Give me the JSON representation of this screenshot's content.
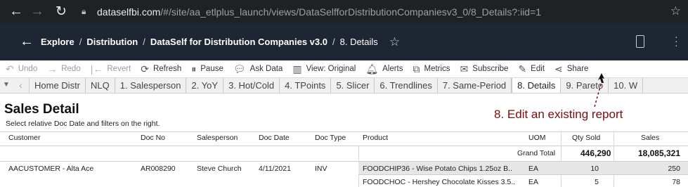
{
  "browser": {
    "url_host": "dataselfbi.com",
    "url_path": "/#/site/aa_etlplus_launch/views/DataSelfforDistributionCompaniesv3_0/8_Details?:iid=1"
  },
  "header": {
    "breadcrumbs": [
      "Explore",
      "Distribution",
      "DataSelf for Distribution Companies v3.0",
      "8. Details"
    ],
    "sep": "/"
  },
  "toolbar": {
    "undo": "Undo",
    "redo": "Redo",
    "revert": "Revert",
    "refresh": "Refresh",
    "pause": "Pause",
    "ask_data": "Ask Data",
    "view": "View: Original",
    "alerts": "Alerts",
    "metrics": "Metrics",
    "subscribe": "Subscribe",
    "edit": "Edit",
    "share": "Share"
  },
  "tabs": [
    "Home Distr",
    "NLQ",
    "1. Salesperson",
    "2. YoY",
    "3. Hot/Cold",
    "4. TPoints",
    "5. Slicer",
    "6. Trendlines",
    "7. Same-Period",
    "8. Details",
    "9. Pareto",
    "10. W"
  ],
  "active_tab": "8. Details",
  "dashboard": {
    "title": "Sales Detail",
    "subtitle": "Select relative Doc Date and filters on the right.",
    "annotation": "8.  Edit an existing report",
    "columns": {
      "customer": "Customer",
      "doc_no": "Doc No",
      "salesperson": "Salesperson",
      "doc_date": "Doc Date",
      "doc_type": "Doc Type",
      "product": "Product",
      "uom": "UOM",
      "qty_sold": "Qty Sold",
      "sales": "Sales"
    },
    "grand_total": {
      "label": "Grand Total",
      "qty": "446,290",
      "sales": "18,085,321"
    },
    "rows": [
      {
        "customer": "AACUSTOMER - Alta Ace",
        "doc_no": "AR008290",
        "salesperson": "Steve Church",
        "doc_date": "4/11/2021",
        "doc_type": "INV",
        "product": "FOODCHIP36 - Wise Potato Chips 1.25oz B..",
        "uom": "EA",
        "qty": "10",
        "sales": "250"
      },
      {
        "customer": "",
        "doc_no": "",
        "salesperson": "",
        "doc_date": "",
        "doc_type": "",
        "product": "FOODCHOC - Hershey Chocolate Kisses 3.5..",
        "uom": "EA",
        "qty": "5",
        "sales": "78"
      }
    ]
  },
  "colors": {
    "chrome": "#202124",
    "header": "#1f2633",
    "annotation": "#7a0d0d",
    "row_highlight": "#e6e6e6"
  }
}
